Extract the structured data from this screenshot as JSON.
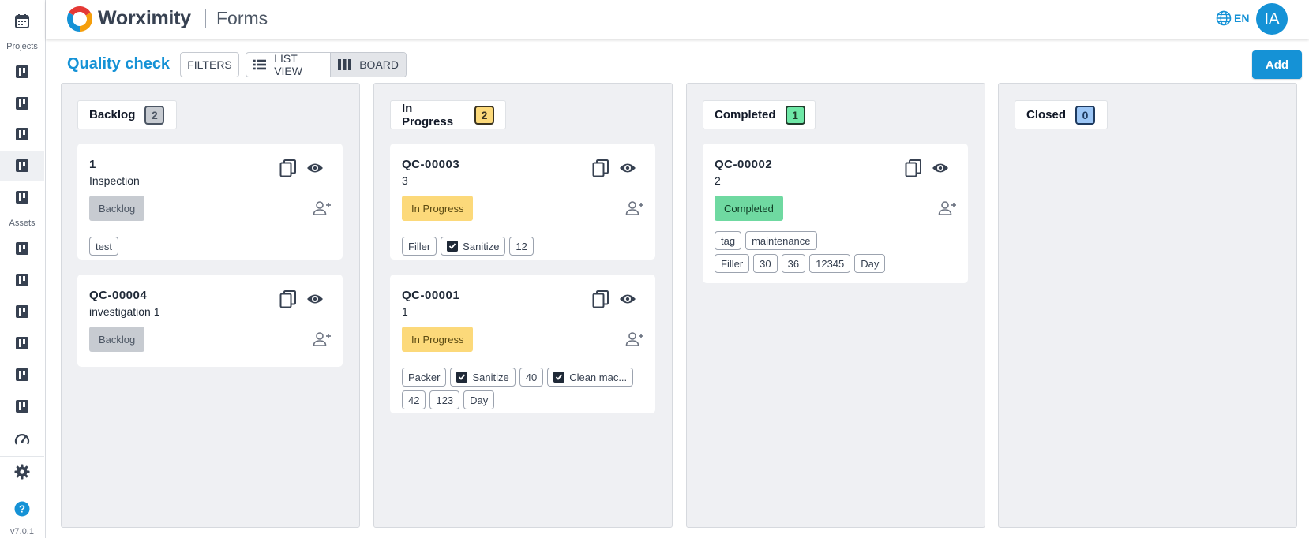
{
  "header": {
    "brand": "Worximity",
    "app_name": "Forms",
    "language": "EN",
    "avatar_initials": "IA",
    "accent_color": "#1592d6"
  },
  "sidebar": {
    "projects_label": "Projects",
    "assets_label": "Assets",
    "version": "v7.0.1"
  },
  "toolbar": {
    "title": "Quality check",
    "filters_label": "FILTERS",
    "list_view_label": "LIST VIEW",
    "board_label": "BOARD",
    "add_label": "Add"
  },
  "columns": [
    {
      "title": "Backlog",
      "count": "2",
      "count_bg": "#c7cbd1",
      "count_border": "#4b5563",
      "cards": [
        {
          "id": "1",
          "desc": "Inspection",
          "status": "Backlog",
          "tags": [
            [
              "test"
            ]
          ]
        },
        {
          "id": "QC-00004",
          "desc": "investigation 1",
          "status": "Backlog",
          "tags": []
        }
      ]
    },
    {
      "title": "In Progress",
      "count": "2",
      "count_bg": "#fcd97a",
      "count_border": "#3a3320",
      "cards": [
        {
          "id": "QC-00003",
          "desc": "3",
          "status": "In Progress",
          "tags": [
            [
              "Filler",
              "Sanitize",
              "12"
            ]
          ],
          "checked": [
            "Sanitize"
          ]
        },
        {
          "id": "QC-00001",
          "desc": "1",
          "status": "In Progress",
          "tags": [
            [
              "Packer",
              "Sanitize",
              "40",
              "Clean mac..."
            ],
            [
              "42",
              "123",
              "Day"
            ]
          ],
          "checked": [
            "Sanitize",
            "Clean mac..."
          ]
        }
      ]
    },
    {
      "title": "Completed",
      "count": "1",
      "count_bg": "#6ee7a6",
      "count_border": "#1f3a2a",
      "cards": [
        {
          "id": "QC-00002",
          "desc": "2",
          "status": "Completed",
          "tags": [
            [
              "tag",
              "maintenance"
            ],
            [
              "Filler",
              "30",
              "36",
              "12345",
              "Day"
            ]
          ]
        }
      ]
    },
    {
      "title": "Closed",
      "count": "0",
      "count_bg": "#9cc6f6",
      "count_border": "#1e3a5f",
      "cards": []
    }
  ],
  "status_colors": {
    "Backlog": "#c7cbd1",
    "In Progress": "#fcd97a",
    "Completed": "#6fd9a1"
  }
}
